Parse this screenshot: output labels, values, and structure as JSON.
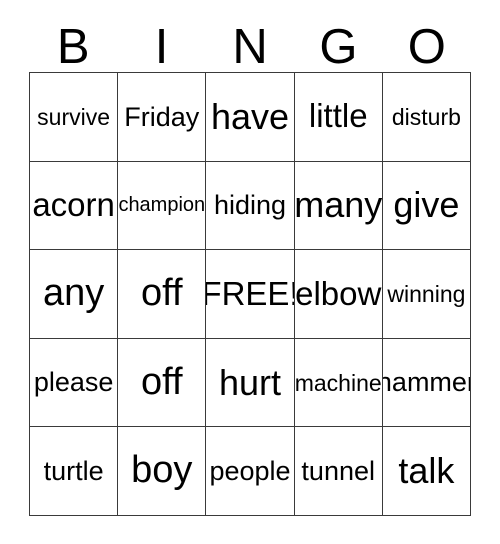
{
  "card": {
    "type": "bingo-card",
    "headers": [
      "B",
      "I",
      "N",
      "G",
      "O"
    ],
    "free_space": "FREE!",
    "colors": {
      "background": "#ffffff",
      "border": "#3a3a3a",
      "text": "#000000"
    },
    "rows": [
      [
        {
          "text": "survive",
          "size_class": "len-7"
        },
        {
          "text": "Friday",
          "size_class": "len-6"
        },
        {
          "text": "have",
          "size_class": "len-4"
        },
        {
          "text": "little",
          "size_class": "len-5"
        },
        {
          "text": "disturb",
          "size_class": "len-7"
        }
      ],
      [
        {
          "text": "acorn",
          "size_class": "len-5"
        },
        {
          "text": "champion",
          "size_class": "len-8"
        },
        {
          "text": "hiding",
          "size_class": "len-6"
        },
        {
          "text": "many",
          "size_class": "len-4"
        },
        {
          "text": "give",
          "size_class": "len-4"
        }
      ],
      [
        {
          "text": "any",
          "size_class": "len-3"
        },
        {
          "text": "off",
          "size_class": "len-3"
        },
        {
          "text": "FREE!",
          "size_class": "len-5"
        },
        {
          "text": "elbow",
          "size_class": "len-5"
        },
        {
          "text": "winning",
          "size_class": "len-7"
        }
      ],
      [
        {
          "text": "please",
          "size_class": "len-6"
        },
        {
          "text": "off",
          "size_class": "len-3"
        },
        {
          "text": "hurt",
          "size_class": "len-4"
        },
        {
          "text": "machine",
          "size_class": "len-7"
        },
        {
          "text": "hammer",
          "size_class": "len-6"
        }
      ],
      [
        {
          "text": "turtle",
          "size_class": "len-6"
        },
        {
          "text": "boy",
          "size_class": "len-3"
        },
        {
          "text": "people",
          "size_class": "len-6"
        },
        {
          "text": "tunnel",
          "size_class": "len-6"
        },
        {
          "text": "talk",
          "size_class": "len-4"
        }
      ]
    ]
  }
}
